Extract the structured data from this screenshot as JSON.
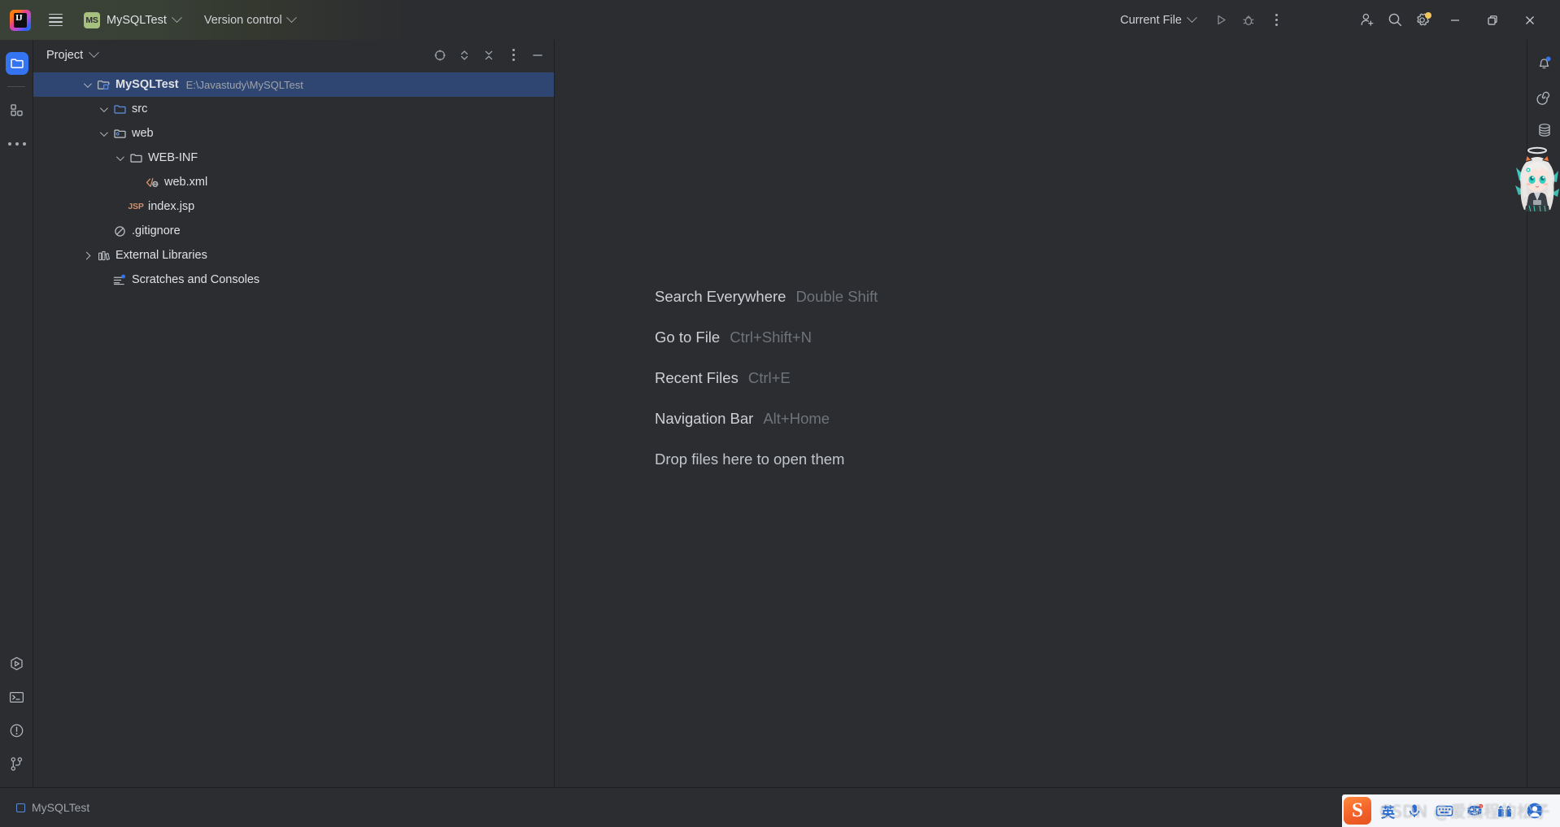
{
  "titlebar": {
    "app_icon": "intellij-idea-logo",
    "app_initials": "IJ",
    "menu_icon": "hamburger-menu-icon",
    "project_badge": "MS",
    "project_name": "MySQLTest",
    "version_control_label": "Version control",
    "run_config_label": "Current File",
    "run_icon": "run-play-icon",
    "debug_icon": "debug-bug-icon",
    "more_icon": "more-vertical-icon",
    "account_icon": "add-account-icon",
    "search_icon": "search-icon",
    "settings_icon": "gear-icon",
    "settings_badge_color": "#f2c55c",
    "minimize_icon": "window-minimize-icon",
    "maximize_icon": "window-restore-icon",
    "close_icon": "window-close-icon"
  },
  "left_rail": {
    "top_items": [
      {
        "name": "project-tool-window",
        "icon": "folder-icon",
        "active": true
      },
      {
        "name": "structure-tool-window",
        "icon": "structure-squares-icon",
        "active": false
      },
      {
        "name": "more-tool-windows",
        "icon": "more-horizontal-icon",
        "active": false
      }
    ],
    "bottom_items": [
      {
        "name": "run-tool-window",
        "icon": "run-hexagon-icon"
      },
      {
        "name": "terminal-tool-window",
        "icon": "terminal-icon"
      },
      {
        "name": "problems-tool-window",
        "icon": "problems-warning-icon"
      },
      {
        "name": "version-control-tool-window",
        "icon": "git-branch-icon"
      }
    ]
  },
  "right_rail": {
    "items": [
      {
        "name": "notifications",
        "icon": "bell-icon",
        "badge": true,
        "badge_color": "#3574f0"
      },
      {
        "name": "ai-assistant",
        "icon": "spiral-icon",
        "badge": false
      },
      {
        "name": "database",
        "icon": "database-cylinder-icon",
        "badge": false
      }
    ],
    "sticker": "anime-character-sticker"
  },
  "project_panel": {
    "title": "Project",
    "title_chevron": "chevron-down-icon",
    "actions": [
      {
        "name": "select-opened-file",
        "icon": "crosshair-target-icon"
      },
      {
        "name": "expand-collapse",
        "icon": "up-down-chevrons-icon"
      },
      {
        "name": "collapse-all",
        "icon": "collapse-all-icon"
      },
      {
        "name": "panel-options",
        "icon": "more-vertical-icon"
      },
      {
        "name": "hide-panel",
        "icon": "minimize-dash-icon"
      }
    ],
    "tree": [
      {
        "label": "MySQLTest",
        "path": "E:\\Javastudy\\MySQLTest",
        "depth": 0,
        "twist": "down",
        "icon": "module-folder-icon",
        "selected": true,
        "bold": true
      },
      {
        "label": "src",
        "path": "",
        "depth": 1,
        "twist": "down",
        "icon": "source-folder-icon",
        "selected": false,
        "bold": false
      },
      {
        "label": "web",
        "path": "",
        "depth": 1,
        "twist": "down",
        "icon": "web-resource-folder-icon",
        "selected": false,
        "bold": false
      },
      {
        "label": "WEB-INF",
        "path": "",
        "depth": 2,
        "twist": "down",
        "icon": "folder-icon",
        "selected": false,
        "bold": false
      },
      {
        "label": "web.xml",
        "path": "",
        "depth": 3,
        "twist": "none",
        "icon": "xml-web-file-icon",
        "selected": false,
        "bold": false
      },
      {
        "label": "index.jsp",
        "path": "",
        "depth": 2,
        "twist": "none",
        "icon": "jsp-file-icon",
        "selected": false,
        "bold": false
      },
      {
        "label": ".gitignore",
        "path": "",
        "depth": 1,
        "twist": "none",
        "icon": "gitignore-file-icon",
        "selected": false,
        "bold": false
      },
      {
        "label": "External Libraries",
        "path": "",
        "depth": 0,
        "twist": "right",
        "icon": "libraries-icon",
        "selected": false,
        "bold": false
      },
      {
        "label": "Scratches and Consoles",
        "path": "",
        "depth": 0,
        "twist": "none",
        "icon": "scratches-icon",
        "selected": false,
        "bold": false
      }
    ]
  },
  "editor": {
    "hints": [
      {
        "label": "Search Everywhere",
        "key": "Double Shift"
      },
      {
        "label": "Go to File",
        "key": "Ctrl+Shift+N"
      },
      {
        "label": "Recent Files",
        "key": "Ctrl+E"
      },
      {
        "label": "Navigation Bar",
        "key": "Alt+Home"
      },
      {
        "label": "Drop files here to open them",
        "key": ""
      }
    ]
  },
  "statusbar": {
    "project_label": "MySQLTest",
    "project_icon": "project-square-icon"
  },
  "ime": {
    "logo": "sogou-pinyin-logo",
    "logo_letter": "S",
    "mode_label": "英",
    "icons": [
      {
        "name": "voice-input-icon"
      },
      {
        "name": "keyboard-icon"
      },
      {
        "name": "emoji-face-icon"
      },
      {
        "name": "toolbox-icon"
      },
      {
        "name": "user-profile-icon"
      }
    ]
  },
  "watermark": {
    "text": "CSDN @爱编程的松子"
  },
  "colors": {
    "accent_blue": "#3574f0",
    "selection_blue": "#2f4673",
    "panel_bg": "#2b2d30",
    "window_bg": "#1e1f22",
    "text_primary": "#dfe1e5",
    "text_secondary": "#9fa3a9",
    "badge_yellow": "#f2c55c",
    "module_green": "#a7c080",
    "jsp_orange": "#cf8e6d"
  }
}
